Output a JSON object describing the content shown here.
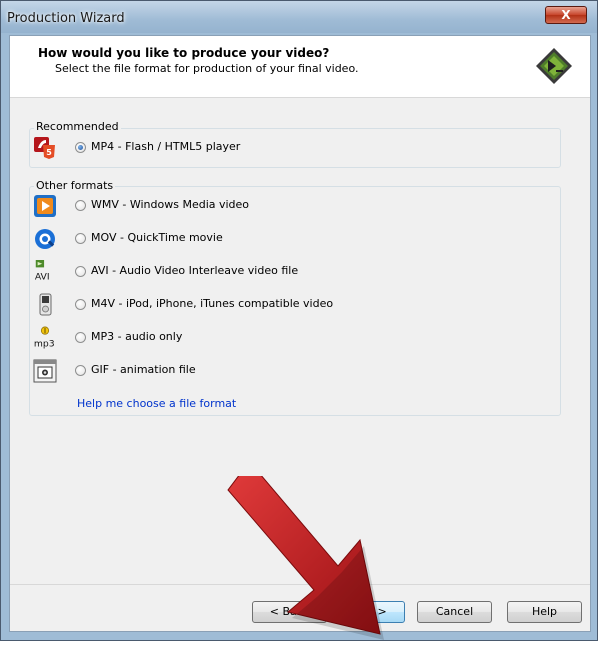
{
  "window": {
    "title": "Production Wizard",
    "close_label": "X"
  },
  "header": {
    "title": "How would you like to produce your video?",
    "subtitle": "Select the file format for production of your final video."
  },
  "recommended": {
    "label": "Recommended",
    "options": [
      {
        "label": "MP4 - Flash / HTML5 player",
        "icon": "mp4-html5-icon",
        "selected": true
      }
    ]
  },
  "other": {
    "label": "Other formats",
    "options": [
      {
        "label": "WMV - Windows Media video",
        "icon": "wmv-icon",
        "selected": false
      },
      {
        "label": "MOV - QuickTime movie",
        "icon": "quicktime-icon",
        "selected": false
      },
      {
        "label": "AVI - Audio Video Interleave video file",
        "icon": "avi-icon",
        "selected": false
      },
      {
        "label": "M4V - iPod, iPhone, iTunes compatible video",
        "icon": "ipod-icon",
        "selected": false
      },
      {
        "label": "MP3 - audio only",
        "icon": "mp3-icon",
        "selected": false
      },
      {
        "label": "GIF - animation file",
        "icon": "gif-icon",
        "selected": false
      }
    ],
    "avi_icon_text": "AVI",
    "mp3_icon_text": "mp3"
  },
  "help_link": "Help me choose a file format",
  "buttons": {
    "back": "< Back",
    "next": "Next >",
    "cancel": "Cancel",
    "help": "Help"
  },
  "colors": {
    "arrow": "#c0181c",
    "link": "#0033cc",
    "titlebar": "#9fbbd5"
  }
}
